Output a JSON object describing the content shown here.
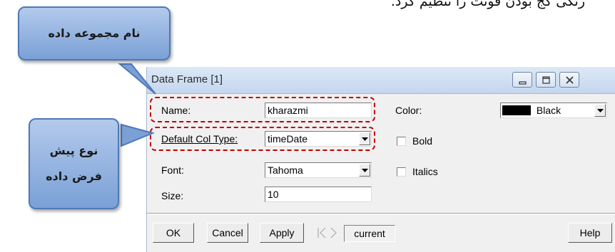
{
  "instruction_text": "رنگی کج بودن فونت را تنظیم کرد.",
  "callouts": {
    "dataset_name": "نام مجموعه داده",
    "default_type_line1": "نوع پیش",
    "default_type_line2": "فرض داده"
  },
  "window": {
    "title": "Data Frame [1]",
    "controls": [
      "minimize-icon",
      "maximize-icon",
      "close-icon"
    ]
  },
  "form": {
    "name_label": "Name:",
    "name_value": "kharazmi",
    "col_type_label": "Default Col Type:",
    "col_type_value": "timeDate",
    "font_label": "Font:",
    "font_value": "Tahoma",
    "size_label": "Size:",
    "size_value": "10",
    "color_label": "Color:",
    "color_value": "Black",
    "color_swatch": "#000000",
    "bold_label": "Bold",
    "italics_label": "Italics"
  },
  "buttons": {
    "ok": "OK",
    "cancel": "Cancel",
    "apply": "Apply",
    "current": "current",
    "help": "Help"
  },
  "colors": {
    "callout_fill": "#7aa0d6",
    "highlight": "#c00000"
  }
}
